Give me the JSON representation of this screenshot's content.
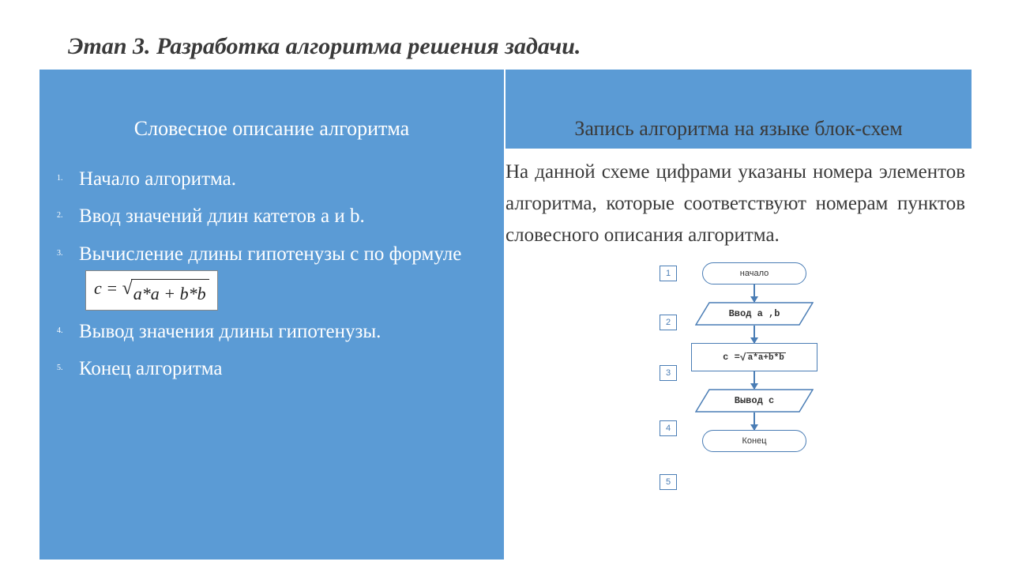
{
  "title": "Этап 3. Разработка алгоритма решения задачи.",
  "headers": {
    "left": "Словесное описание алгоритма",
    "right": "Запись алгоритма на языке блок-схем"
  },
  "steps": [
    "Начало алгоритма.",
    "Ввод значений длин катетов a и b.",
    "Вычисление длины гипотенузы с по формуле",
    "Вывод значения длины гипотенузы.",
    "Конец алгоритма"
  ],
  "formula": {
    "lhs": "c = ",
    "radicand": "a*a + b*b"
  },
  "right_paragraph": "На данной схеме цифрами указаны номера элементов алгоритма, которые соответствуют номерам пунктов словесного описания алгоритма.",
  "flowchart": {
    "numbers": [
      "1",
      "2",
      "3",
      "4",
      "5"
    ],
    "nodes": {
      "start": "начало",
      "input": "Ввод a ,b",
      "process_lhs": "c = ",
      "process_rad": "a*a+b*b",
      "output": "Вывод с",
      "end": "Конец"
    }
  }
}
